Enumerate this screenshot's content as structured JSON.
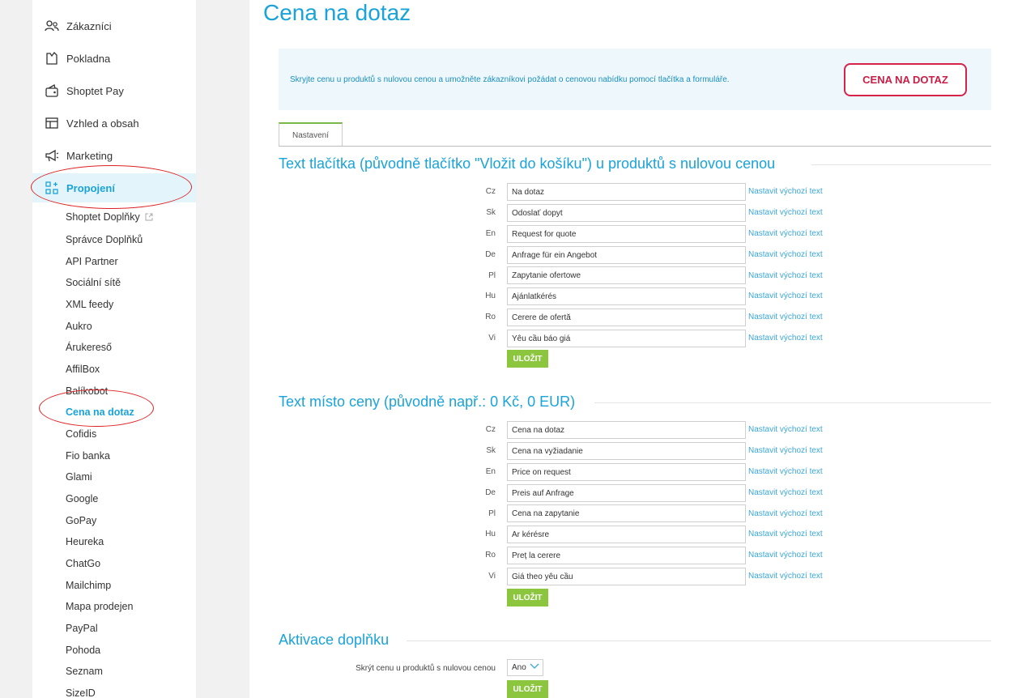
{
  "sidebar": {
    "items": [
      {
        "label": "Zákazníci",
        "icon": "customers-icon"
      },
      {
        "label": "Pokladna",
        "icon": "cash-register-icon"
      },
      {
        "label": "Shoptet Pay",
        "icon": "wallet-icon"
      },
      {
        "label": "Vzhled a obsah",
        "icon": "layout-icon"
      },
      {
        "label": "Marketing",
        "icon": "megaphone-icon"
      },
      {
        "label": "Propojení",
        "icon": "integrations-icon"
      }
    ],
    "subitems": [
      "Shoptet Doplňky",
      "Správce Doplňků",
      "API Partner",
      "Sociální sítě",
      "XML feedy",
      "Aukro",
      "Árukereső",
      "AffilBox",
      "Balíkobot",
      "Cena na dotaz",
      "Cofidis",
      "Fio banka",
      "Glami",
      "Google",
      "GoPay",
      "Heureka",
      "ChatGo",
      "Mailchimp",
      "Mapa prodejen",
      "PayPal",
      "Pohoda",
      "Seznam",
      "SizeID"
    ]
  },
  "page": {
    "title": "Cena na dotaz",
    "banner_text": "Skryjte cenu u produktů s nulovou cenou a umožněte zákazníkovi požádat o cenovou nabídku pomocí tlačítka a formuláře.",
    "banner_button": "CENA NA DOTAZ",
    "tab": "Nastavení"
  },
  "section1": {
    "title": "Text tlačítka (původně tlačítko \"Vložit do košíku\") u produktů s nulovou cenou",
    "rows": [
      {
        "lang": "Cz",
        "value": "Na dotaz"
      },
      {
        "lang": "Sk",
        "value": "Odoslať dopyt"
      },
      {
        "lang": "En",
        "value": "Request for quote"
      },
      {
        "lang": "De",
        "value": "Anfrage für ein Angebot"
      },
      {
        "lang": "Pl",
        "value": "Zapytanie ofertowe"
      },
      {
        "lang": "Hu",
        "value": "Ajánlatkérés"
      },
      {
        "lang": "Ro",
        "value": "Cerere de ofertă"
      },
      {
        "lang": "Vi",
        "value": "Yêu cầu báo giá"
      }
    ],
    "reset_label": "Nastavit výchozí text",
    "save_label": "ULOŽIT"
  },
  "section2": {
    "title": "Text místo ceny (původně např.: 0 Kč, 0 EUR)",
    "rows": [
      {
        "lang": "Cz",
        "value": "Cena na dotaz"
      },
      {
        "lang": "Sk",
        "value": "Cena na vyžiadanie"
      },
      {
        "lang": "En",
        "value": "Price on request"
      },
      {
        "lang": "De",
        "value": "Preis auf Anfrage"
      },
      {
        "lang": "Pl",
        "value": "Cena na zapytanie"
      },
      {
        "lang": "Hu",
        "value": "Ár kérésre"
      },
      {
        "lang": "Ro",
        "value": "Preț la cerere"
      },
      {
        "lang": "Vi",
        "value": "Giá theo yêu cầu"
      }
    ],
    "reset_label": "Nastavit výchozí text",
    "save_label": "ULOŽIT"
  },
  "section3": {
    "title": "Aktivace doplňku",
    "label": "Skrýt cenu u produktů s nulovou cenou",
    "select_value": "Ano",
    "save_label": "ULOŽIT"
  },
  "colors": {
    "accent": "#1aa3d9",
    "save": "#8cc63f",
    "highlight_oval": "#dd2222",
    "banner_button_border": "#d6234a"
  }
}
